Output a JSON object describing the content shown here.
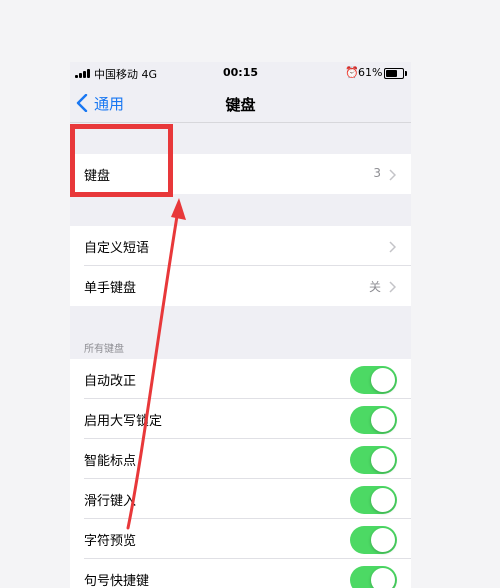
{
  "status_bar": {
    "carrier": "中国移动  4G",
    "time": "00:15",
    "alarm_icon": "alarm-clock-icon",
    "battery_percent": "61%",
    "battery_level": 0.61
  },
  "nav": {
    "back_label": "通用",
    "title": "键盘"
  },
  "rows_group1": [
    {
      "label": "键盘",
      "value": "3"
    }
  ],
  "rows_group2": [
    {
      "label": "自定义短语",
      "value": ""
    },
    {
      "label": "单手键盘",
      "value": "关"
    }
  ],
  "section_header": "所有键盘",
  "toggles": [
    {
      "label": "自动改正",
      "on": true
    },
    {
      "label": "启用大写锁定",
      "on": true
    },
    {
      "label": "智能标点",
      "on": true
    },
    {
      "label": "滑行键入",
      "on": true
    },
    {
      "label": "字符预览",
      "on": true
    },
    {
      "label": "句号快捷键",
      "on": true
    }
  ],
  "colors": {
    "accent": "#1877f2",
    "toggle_on": "#4cd964",
    "annotation": "#e8383a"
  }
}
